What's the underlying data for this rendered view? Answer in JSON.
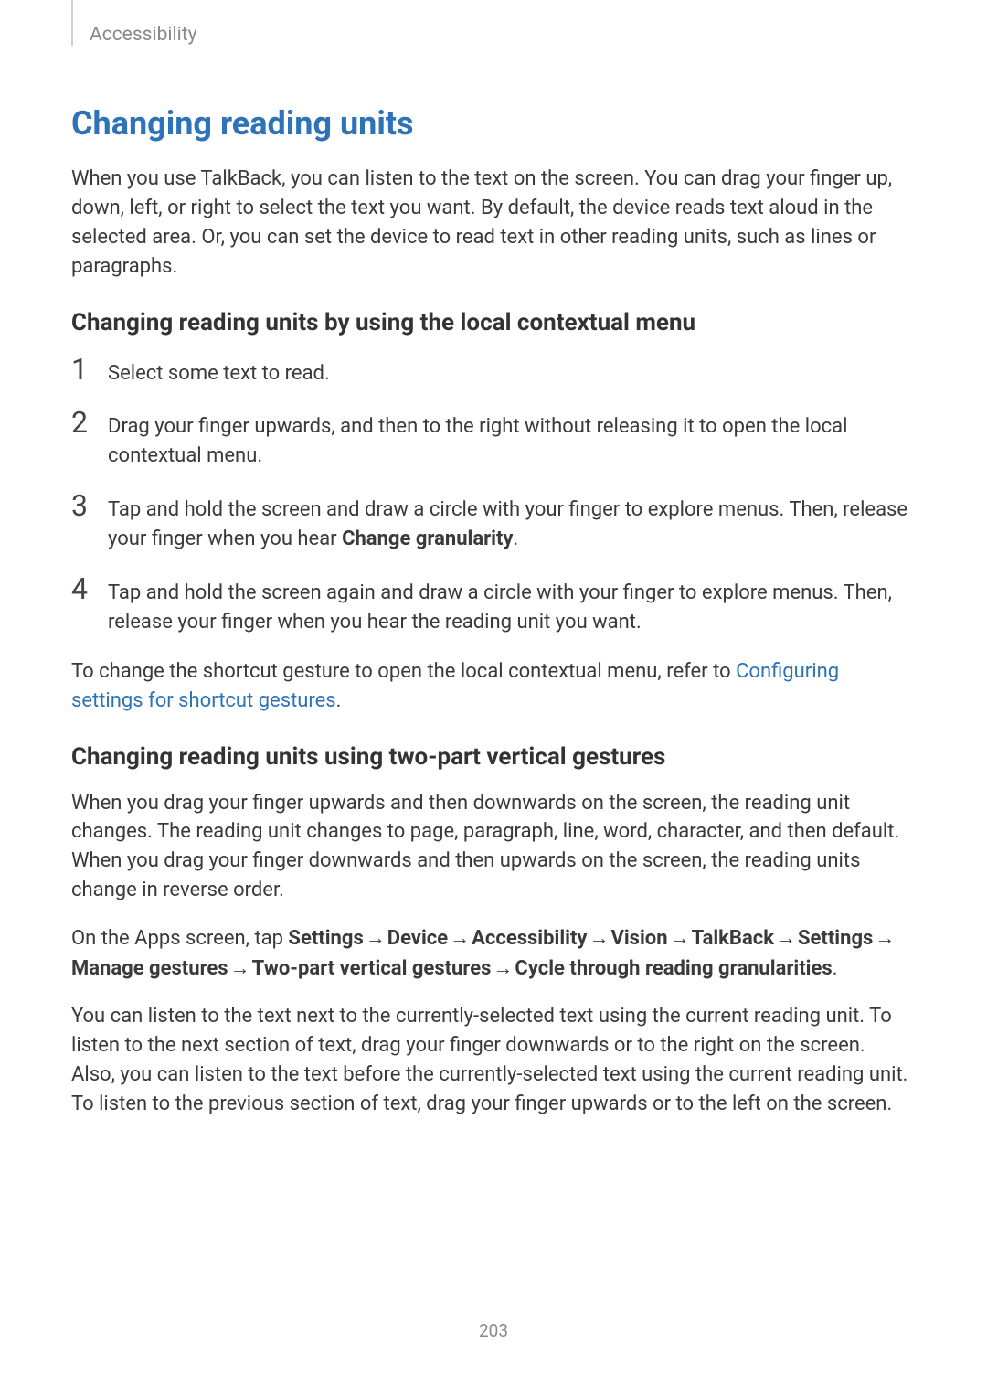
{
  "header": {
    "section_label": "Accessibility"
  },
  "title": "Changing reading units",
  "intro": "When you use TalkBack, you can listen to the text on the screen. You can drag your finger up, down, left, or right to select the text you want. By default, the device reads text aloud in the selected area. Or, you can set the device to read text in other reading units, such as lines or paragraphs.",
  "sub1": {
    "heading": "Changing reading units by using the local contextual menu",
    "steps": [
      {
        "num": "1",
        "text": "Select some text to read."
      },
      {
        "num": "2",
        "text": "Drag your finger upwards, and then to the right without releasing it to open the local contextual menu."
      },
      {
        "num": "3",
        "text_pre": "Tap and hold the screen and draw a circle with your finger to explore menus. Then, release your finger when you hear ",
        "bold": "Change granularity",
        "text_post": "."
      },
      {
        "num": "4",
        "text": "Tap and hold the screen again and draw a circle with your finger to explore menus. Then, release your finger when you hear the reading unit you want."
      }
    ],
    "note_pre": "To change the shortcut gesture to open the local contextual menu, refer to ",
    "note_link": "Configuring settings for shortcut gestures",
    "note_post": "."
  },
  "sub2": {
    "heading": "Changing reading units using two-part vertical gestures",
    "p1": "When you drag your finger upwards and then downwards on the screen, the reading unit changes. The reading unit changes to page, paragraph, line, word, character, and then default. When you drag your finger downwards and then upwards on the screen, the reading units change in reverse order.",
    "nav": {
      "prefix": "On the Apps screen, tap ",
      "parts": [
        "Settings",
        "Device",
        "Accessibility",
        "Vision",
        "TalkBack",
        "Settings",
        "Manage gestures",
        "Two-part vertical gestures",
        "Cycle through reading granularities"
      ],
      "suffix": "."
    },
    "p2": "You can listen to the text next to the currently-selected text using the current reading unit. To listen to the next section of text, drag your finger downwards or to the right on the screen. Also, you can listen to the text before the currently-selected text using the current reading unit. To listen to the previous section of text, drag your finger upwards or to the left on the screen."
  },
  "page_number": "203"
}
